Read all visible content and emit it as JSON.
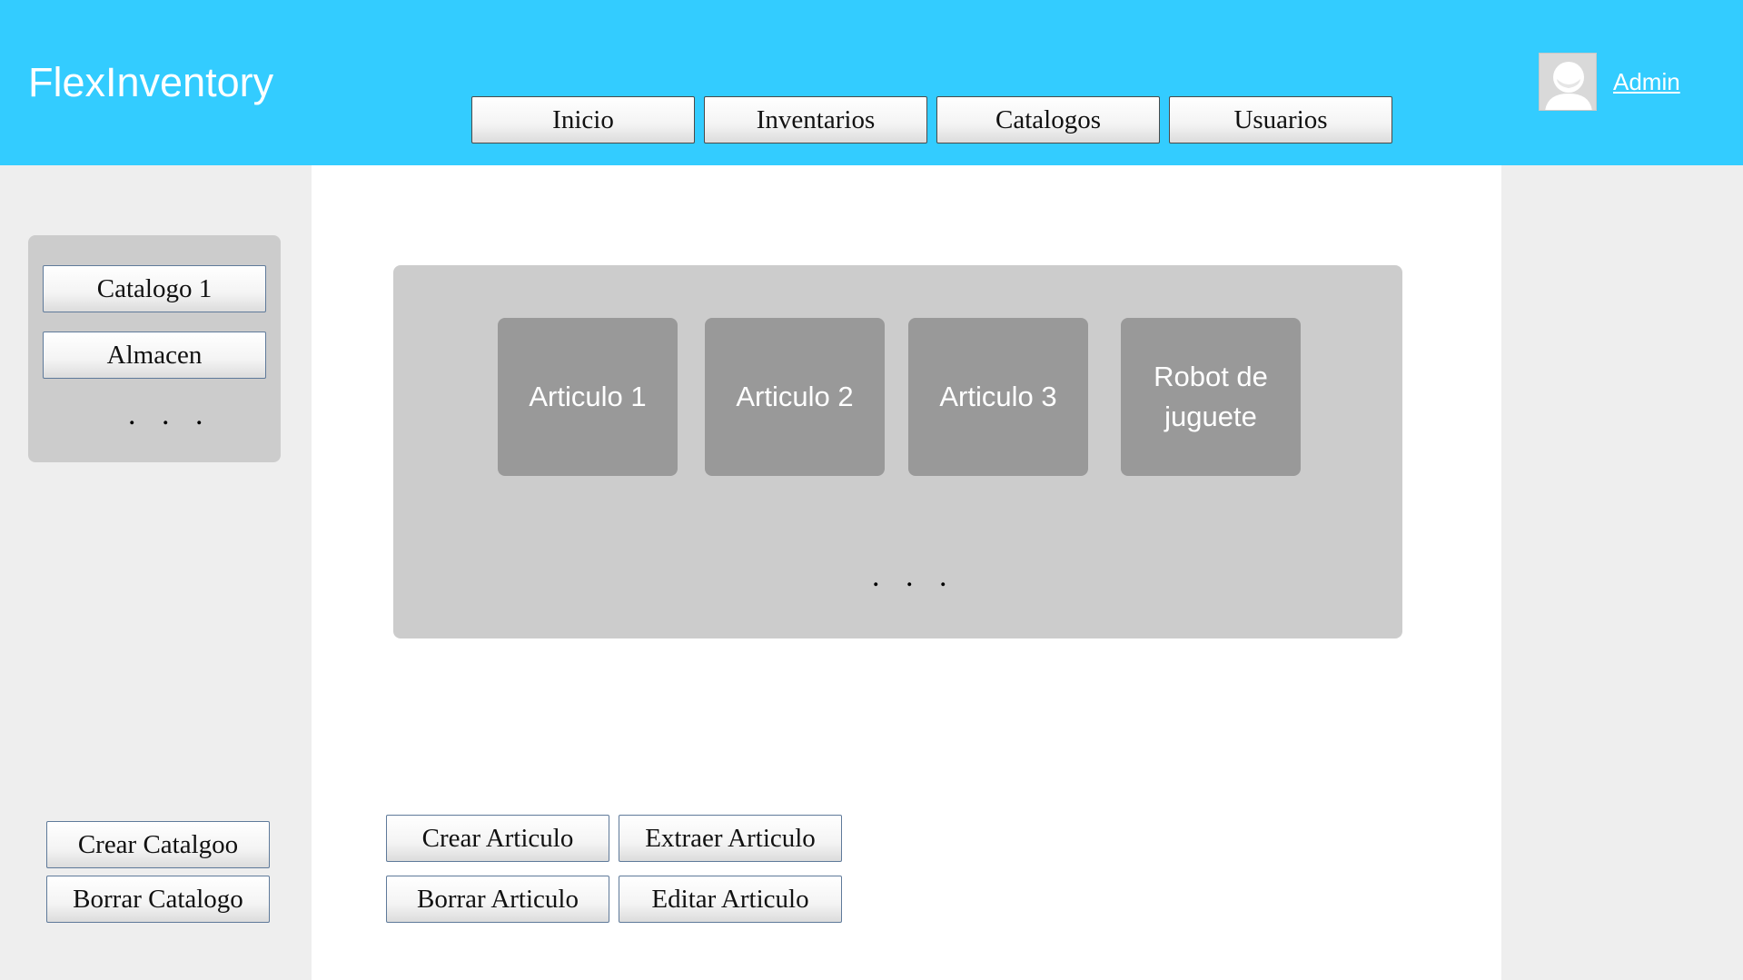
{
  "app": {
    "title": "FlexInventory"
  },
  "nav": {
    "items": [
      {
        "label": "Inicio"
      },
      {
        "label": "Inventarios"
      },
      {
        "label": "Catalogos"
      },
      {
        "label": "Usuarios"
      }
    ]
  },
  "user": {
    "name": "Admin",
    "avatar_icon": "user-avatar-icon"
  },
  "sidebar": {
    "catalogs": [
      {
        "label": "Catalogo 1"
      },
      {
        "label": "Almacen"
      }
    ],
    "more": ". . .",
    "create_label": "Crear Catalgoo",
    "delete_label": "Borrar Catalogo"
  },
  "articles": {
    "items": [
      {
        "label": "Articulo 1"
      },
      {
        "label": "Articulo 2"
      },
      {
        "label": "Articulo 3"
      },
      {
        "label": "Robot de juguete"
      }
    ],
    "more": ". . ."
  },
  "actions": {
    "create": "Crear Articulo",
    "extract": "Extraer Articulo",
    "delete": "Borrar Articulo",
    "edit": "Editar Articulo"
  },
  "colors": {
    "header": "#33CCFF",
    "sidebar": "#EEEEEE",
    "panel": "#CCCCCC",
    "card": "#999999"
  }
}
